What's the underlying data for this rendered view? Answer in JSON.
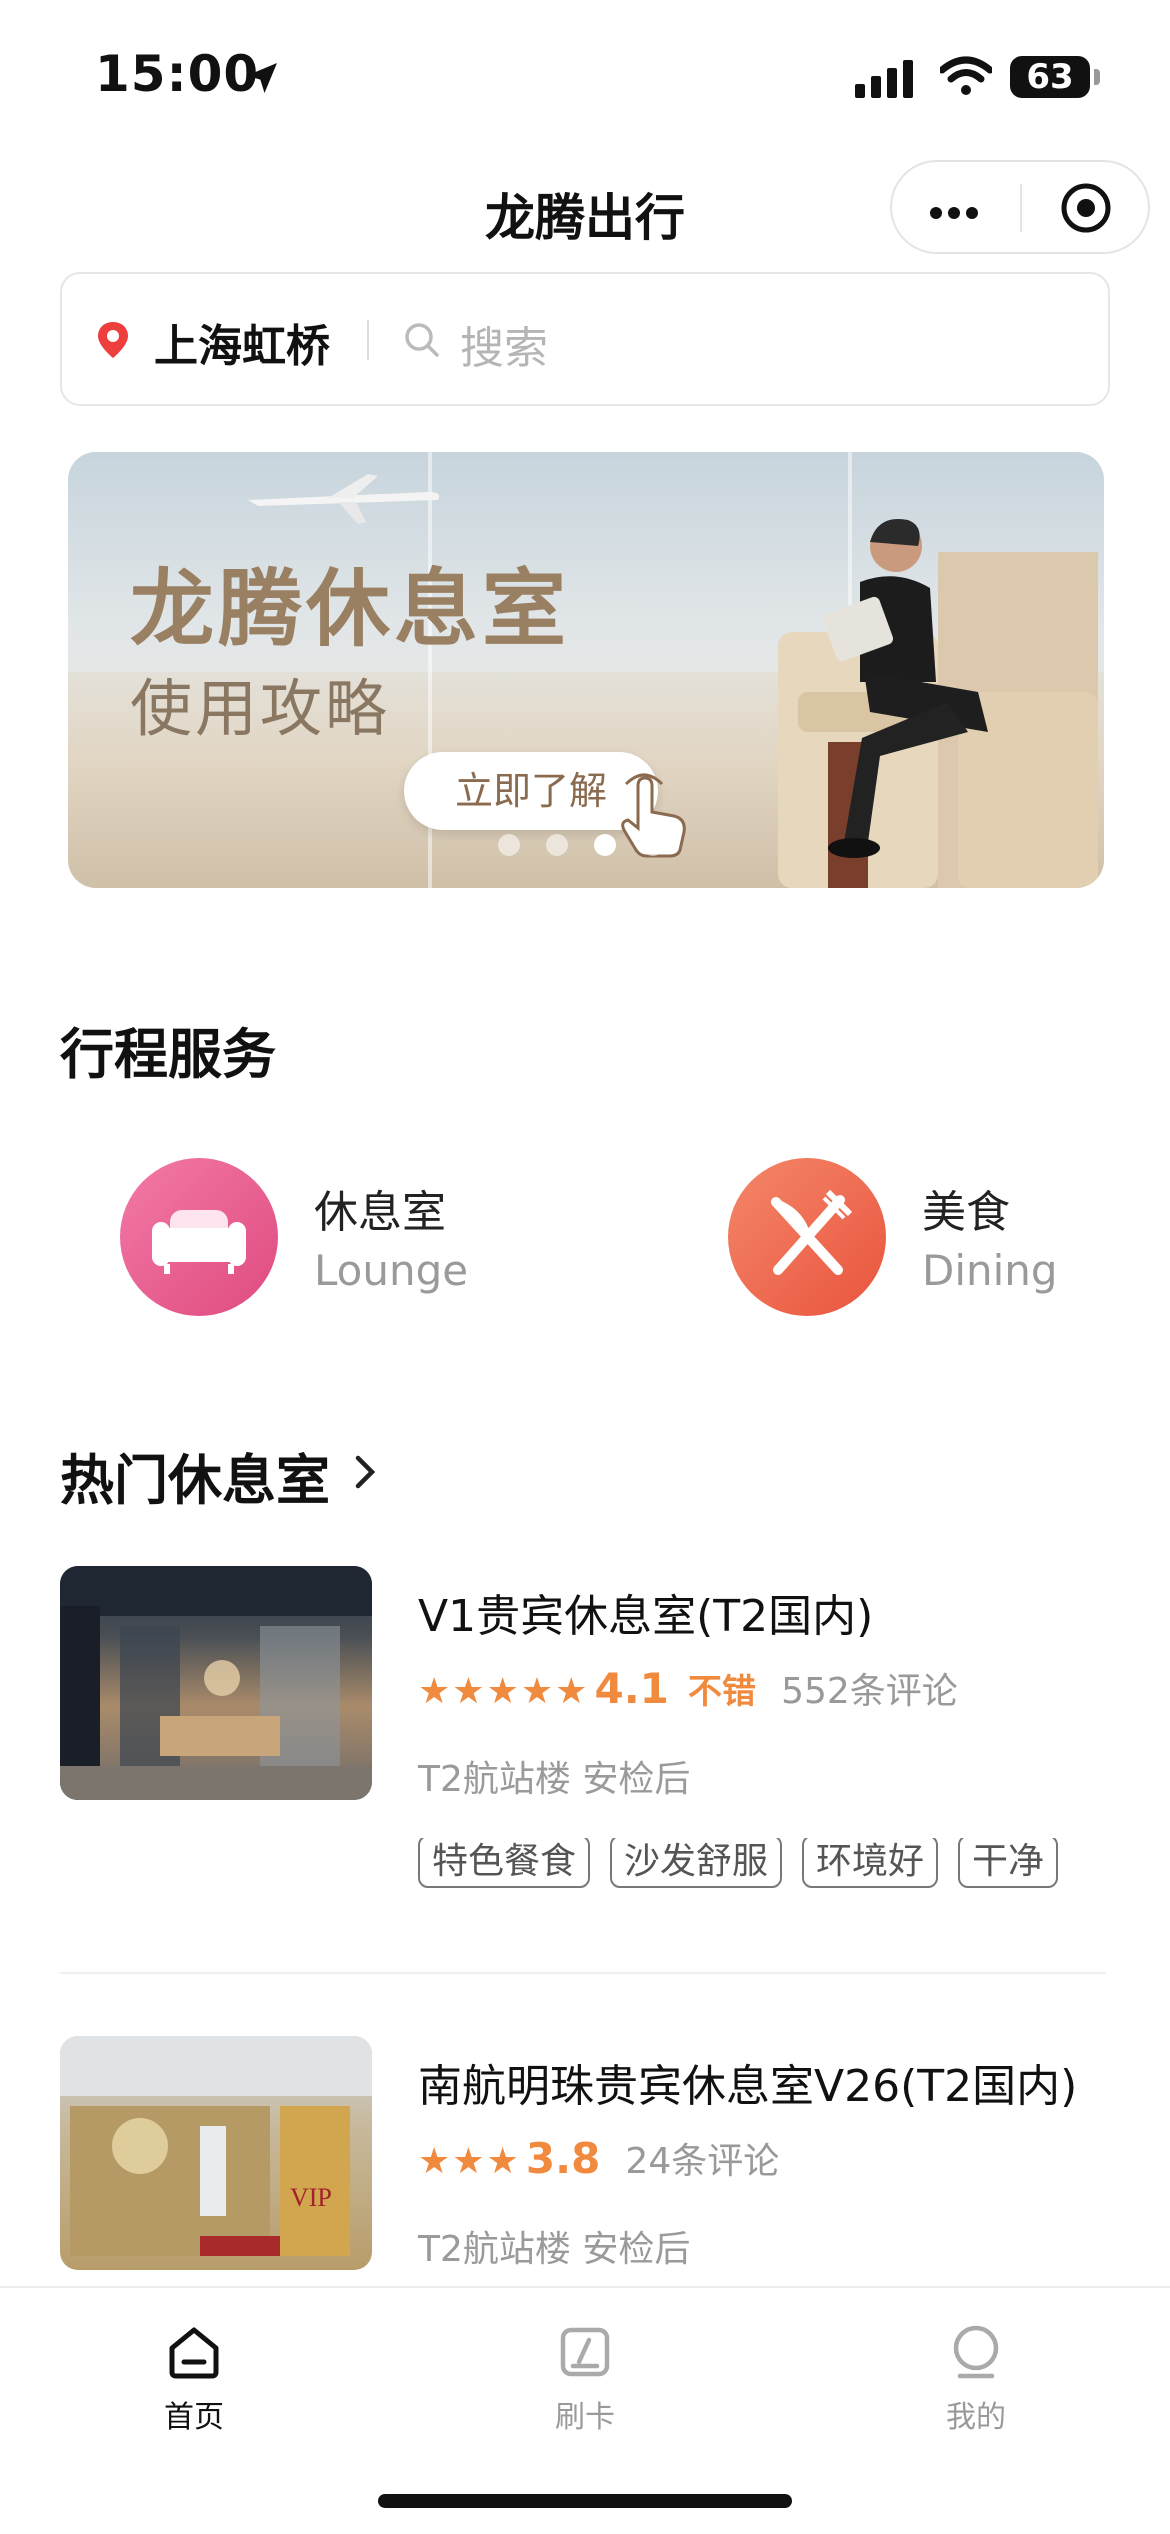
{
  "status_bar": {
    "time": "15:00",
    "battery": "63"
  },
  "nav": {
    "title": "龙腾出行"
  },
  "search": {
    "city": "上海虹桥",
    "placeholder": "搜索"
  },
  "banner": {
    "title": "龙腾休息室",
    "subtitle": "使用攻略",
    "cta": "立即了解",
    "slide_count": 4,
    "active_slide": 3
  },
  "services": {
    "title": "行程服务",
    "items": [
      {
        "name": "休息室",
        "en": "Lounge",
        "icon": "sofa-icon",
        "color": "#e8558a"
      },
      {
        "name": "美食",
        "en": "Dining",
        "icon": "fork-knife-icon",
        "color": "#ee6a4d"
      }
    ]
  },
  "hot": {
    "title": "热门休息室",
    "items": [
      {
        "name": "V1贵宾休息室(T2国内)",
        "stars": 5,
        "score": "4.1",
        "rating_word": "不错",
        "reviews": "552条评论",
        "location": "T2航站楼 安检后",
        "tags": [
          "特色餐食",
          "沙发舒服",
          "环境好",
          "干净"
        ]
      },
      {
        "name": "南航明珠贵宾休息室V26(T2国内)",
        "stars": 3,
        "score": "3.8",
        "reviews": "24条评论",
        "location": "T2航站楼 安检后"
      }
    ]
  },
  "tabbar": {
    "items": [
      {
        "label": "首页",
        "icon": "home-icon",
        "active": true
      },
      {
        "label": "刷卡",
        "icon": "card-swipe-icon",
        "active": false
      },
      {
        "label": "我的",
        "icon": "profile-icon",
        "active": false
      }
    ]
  },
  "colors": {
    "accent": "#f08a3e",
    "lounge": "#e8558a",
    "dining": "#ee6a4d"
  }
}
